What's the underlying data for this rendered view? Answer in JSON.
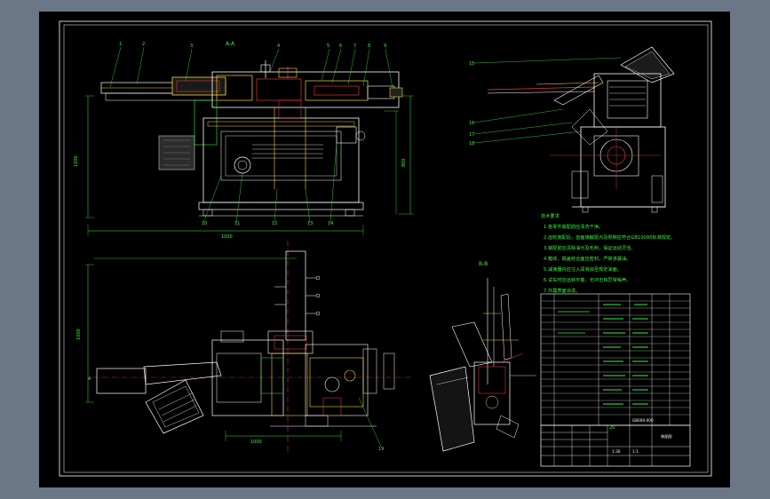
{
  "view_top_label": "A-A",
  "view_side_label": "B-B",
  "dimensions": {
    "front_width": "1000",
    "front_height": "1000",
    "front_right": "800",
    "plan_width": "1000",
    "plan_height": "1000"
  },
  "section_mark": "A",
  "balloons": [
    "1",
    "2",
    "3",
    "4",
    "5",
    "6",
    "7",
    "8",
    "9",
    "10",
    "11",
    "12",
    "13",
    "14",
    "15",
    "16",
    "17",
    "18",
    "19",
    "20"
  ],
  "notes_title": "技术要求",
  "notes": [
    "1.各零件装配前应清洗干净。",
    "2.齿轮装配后，齿面接触斑点及侧隙应符合GB10095标准规定。",
    "3.装配前应清除油污及毛刺，保证运动灵活。",
    "4.箱体、端盖结合面应密封，严禁渗漏油。",
    "5.减速器内应注入润滑油至规定油面。",
    "6.试车时应运转平稳，无冲击和异常噪声。",
    "7.外露表面涂漆。"
  ],
  "title_block": {
    "drawing_no": "GB000-000",
    "scale": "1:1",
    "sheet": "1:30",
    "material": "装配图"
  }
}
